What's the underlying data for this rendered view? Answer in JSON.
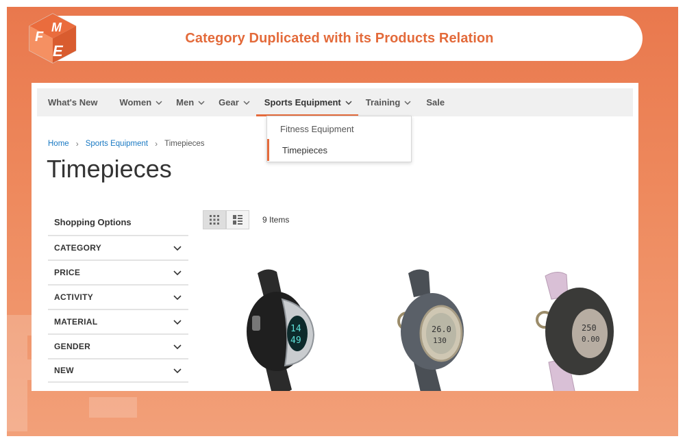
{
  "banner": {
    "title": "Category Duplicated with its Products Relation",
    "logo_letters": [
      "F",
      "M",
      "E"
    ]
  },
  "nav": {
    "items": [
      {
        "label": "What's New",
        "has_dropdown": false
      },
      {
        "label": "Women",
        "has_dropdown": true
      },
      {
        "label": "Men",
        "has_dropdown": true
      },
      {
        "label": "Gear",
        "has_dropdown": true
      },
      {
        "label": "Sports Equipment",
        "has_dropdown": true,
        "active": true
      },
      {
        "label": "Training",
        "has_dropdown": true
      },
      {
        "label": "Sale",
        "has_dropdown": false
      }
    ],
    "dropdown": [
      {
        "label": "Fitness Equipment"
      },
      {
        "label": "Timepieces",
        "active": true
      }
    ]
  },
  "breadcrumb": {
    "home": "Home",
    "parent": "Sports Equipment",
    "current": "Timepieces"
  },
  "page": {
    "title": "Timepieces"
  },
  "sidebar": {
    "heading": "Shopping Options",
    "filters": [
      "CATEGORY",
      "PRICE",
      "ACTIVITY",
      "MATERIAL",
      "GENDER",
      "NEW"
    ]
  },
  "toolbar": {
    "items_count": "9 Items",
    "view_modes": [
      "grid-icon",
      "list-icon"
    ]
  },
  "products": [
    {
      "image": "watch-black-silver-digital-icon"
    },
    {
      "image": "watch-gray-lcd-icon"
    },
    {
      "image": "watch-pink-black-lcd-icon"
    }
  ],
  "colors": {
    "accent": "#e56b3c",
    "link": "#1979c3",
    "banner_bg": "#e9784d"
  }
}
